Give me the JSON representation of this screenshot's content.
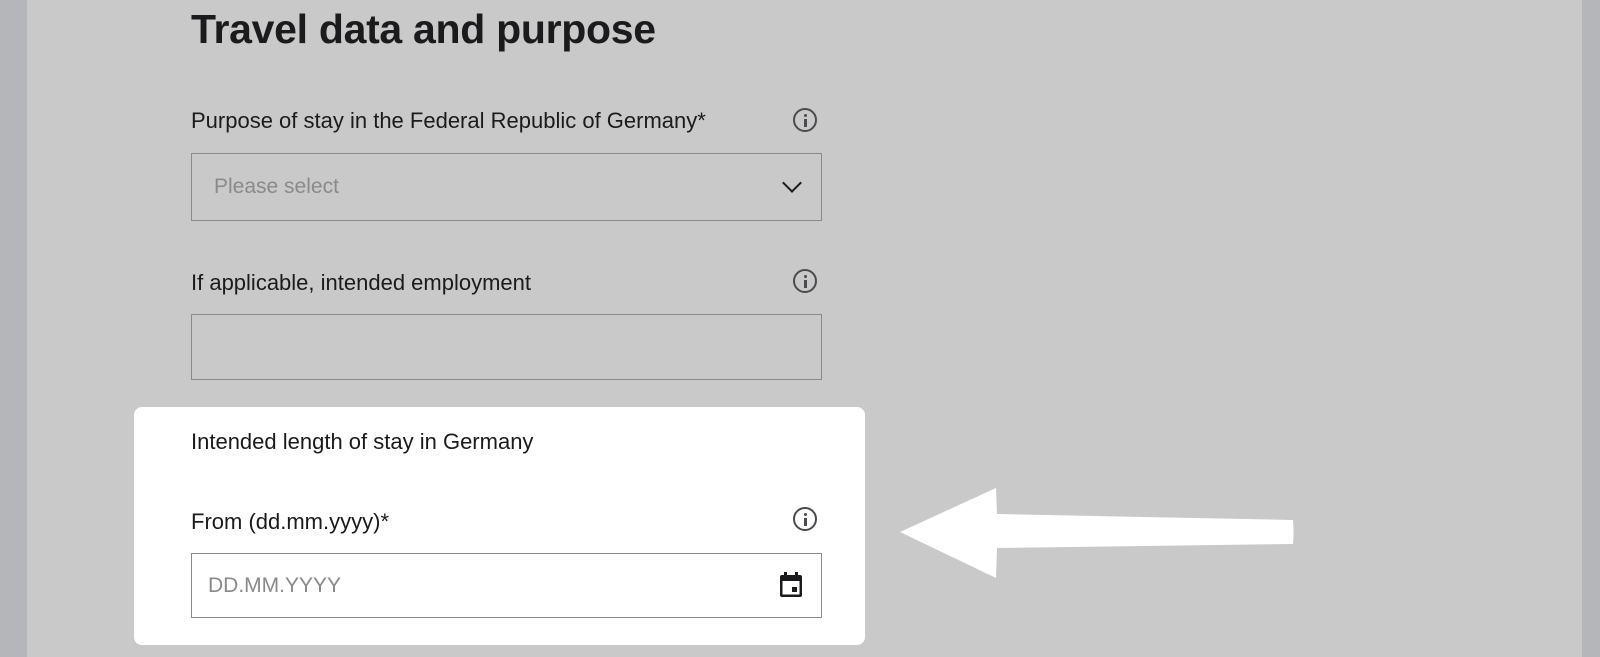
{
  "section": {
    "title": "Travel data and purpose"
  },
  "purpose": {
    "label": "Purpose of stay in the Federal Republic of Germany*",
    "placeholder": "Please select",
    "info_icon": "info-circle-icon",
    "chevron_icon": "chevron-down-icon"
  },
  "employment": {
    "label": "If applicable, intended employment",
    "value": "",
    "info_icon": "info-circle-icon"
  },
  "length_of_stay": {
    "heading": "Intended length of stay in Germany",
    "from_label": "From (dd.mm.yyyy)*",
    "from_placeholder": "DD.MM.YYYY",
    "info_icon": "info-circle-icon",
    "calendar_icon": "calendar-icon"
  },
  "annotation": {
    "arrow_icon": "arrow-left-icon",
    "arrow_color": "#ffffff"
  },
  "colors": {
    "page_background": "#c9c9c9",
    "outer_background": "#b5b6b9",
    "highlight_panel": "#ffffff",
    "text": "#1b1b1d",
    "placeholder": "#8a8a8a"
  }
}
